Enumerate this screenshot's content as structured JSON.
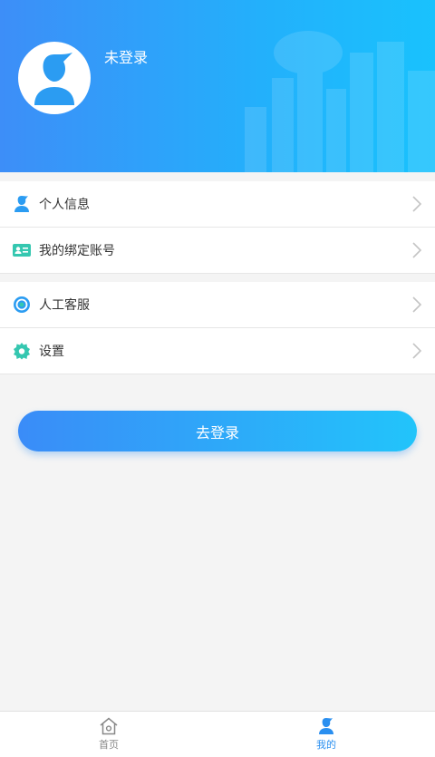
{
  "profile": {
    "username": "未登录",
    "avatar_icon": "user-avatar-icon"
  },
  "menu_group_1": [
    {
      "label": "个人信息",
      "icon": "person-icon"
    },
    {
      "label": "我的绑定账号",
      "icon": "id-card-icon"
    }
  ],
  "menu_group_2": [
    {
      "label": "人工客服",
      "icon": "headset-icon"
    },
    {
      "label": "设置",
      "icon": "gear-icon"
    }
  ],
  "login_button": "去登录",
  "tabs": [
    {
      "label": "首页",
      "icon": "home-icon",
      "active": false
    },
    {
      "label": "我的",
      "icon": "person-icon",
      "active": true
    }
  ],
  "colors": {
    "header_gradient_start": "#3d8ef8",
    "header_gradient_end": "#19c2fd",
    "accent": "#2a8ff0",
    "teal": "#35c7b0"
  }
}
